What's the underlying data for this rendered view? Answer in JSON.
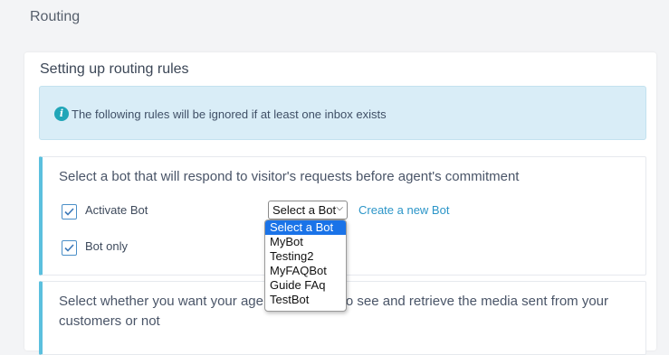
{
  "page": {
    "title": "Routing"
  },
  "card": {
    "title": "Setting up routing rules"
  },
  "alert": {
    "icon": "info-icon",
    "text": "The following rules will be ignored if at least one inbox exists"
  },
  "bot_section": {
    "heading": "Select a bot that will respond to visitor's requests before agent's commitment",
    "activate_label": "Activate Bot",
    "activate_checked": true,
    "bot_only_label": "Bot only",
    "bot_only_checked": true,
    "select_value": "Select a Bot",
    "create_link": "Create a new Bot",
    "options": [
      "Select a Bot",
      "MyBot",
      "Testing2",
      "MyFAQBot",
      "Guide FAq",
      "TestBot"
    ]
  },
  "media_section": {
    "heading": "Select whether you want your agent to be able to see and retrieve the media sent from your customers or not"
  },
  "colors": {
    "accent": "#5bc0de",
    "link": "#2b95c8",
    "alert_bg": "#d9edf7",
    "selected": "#1a73e8"
  }
}
